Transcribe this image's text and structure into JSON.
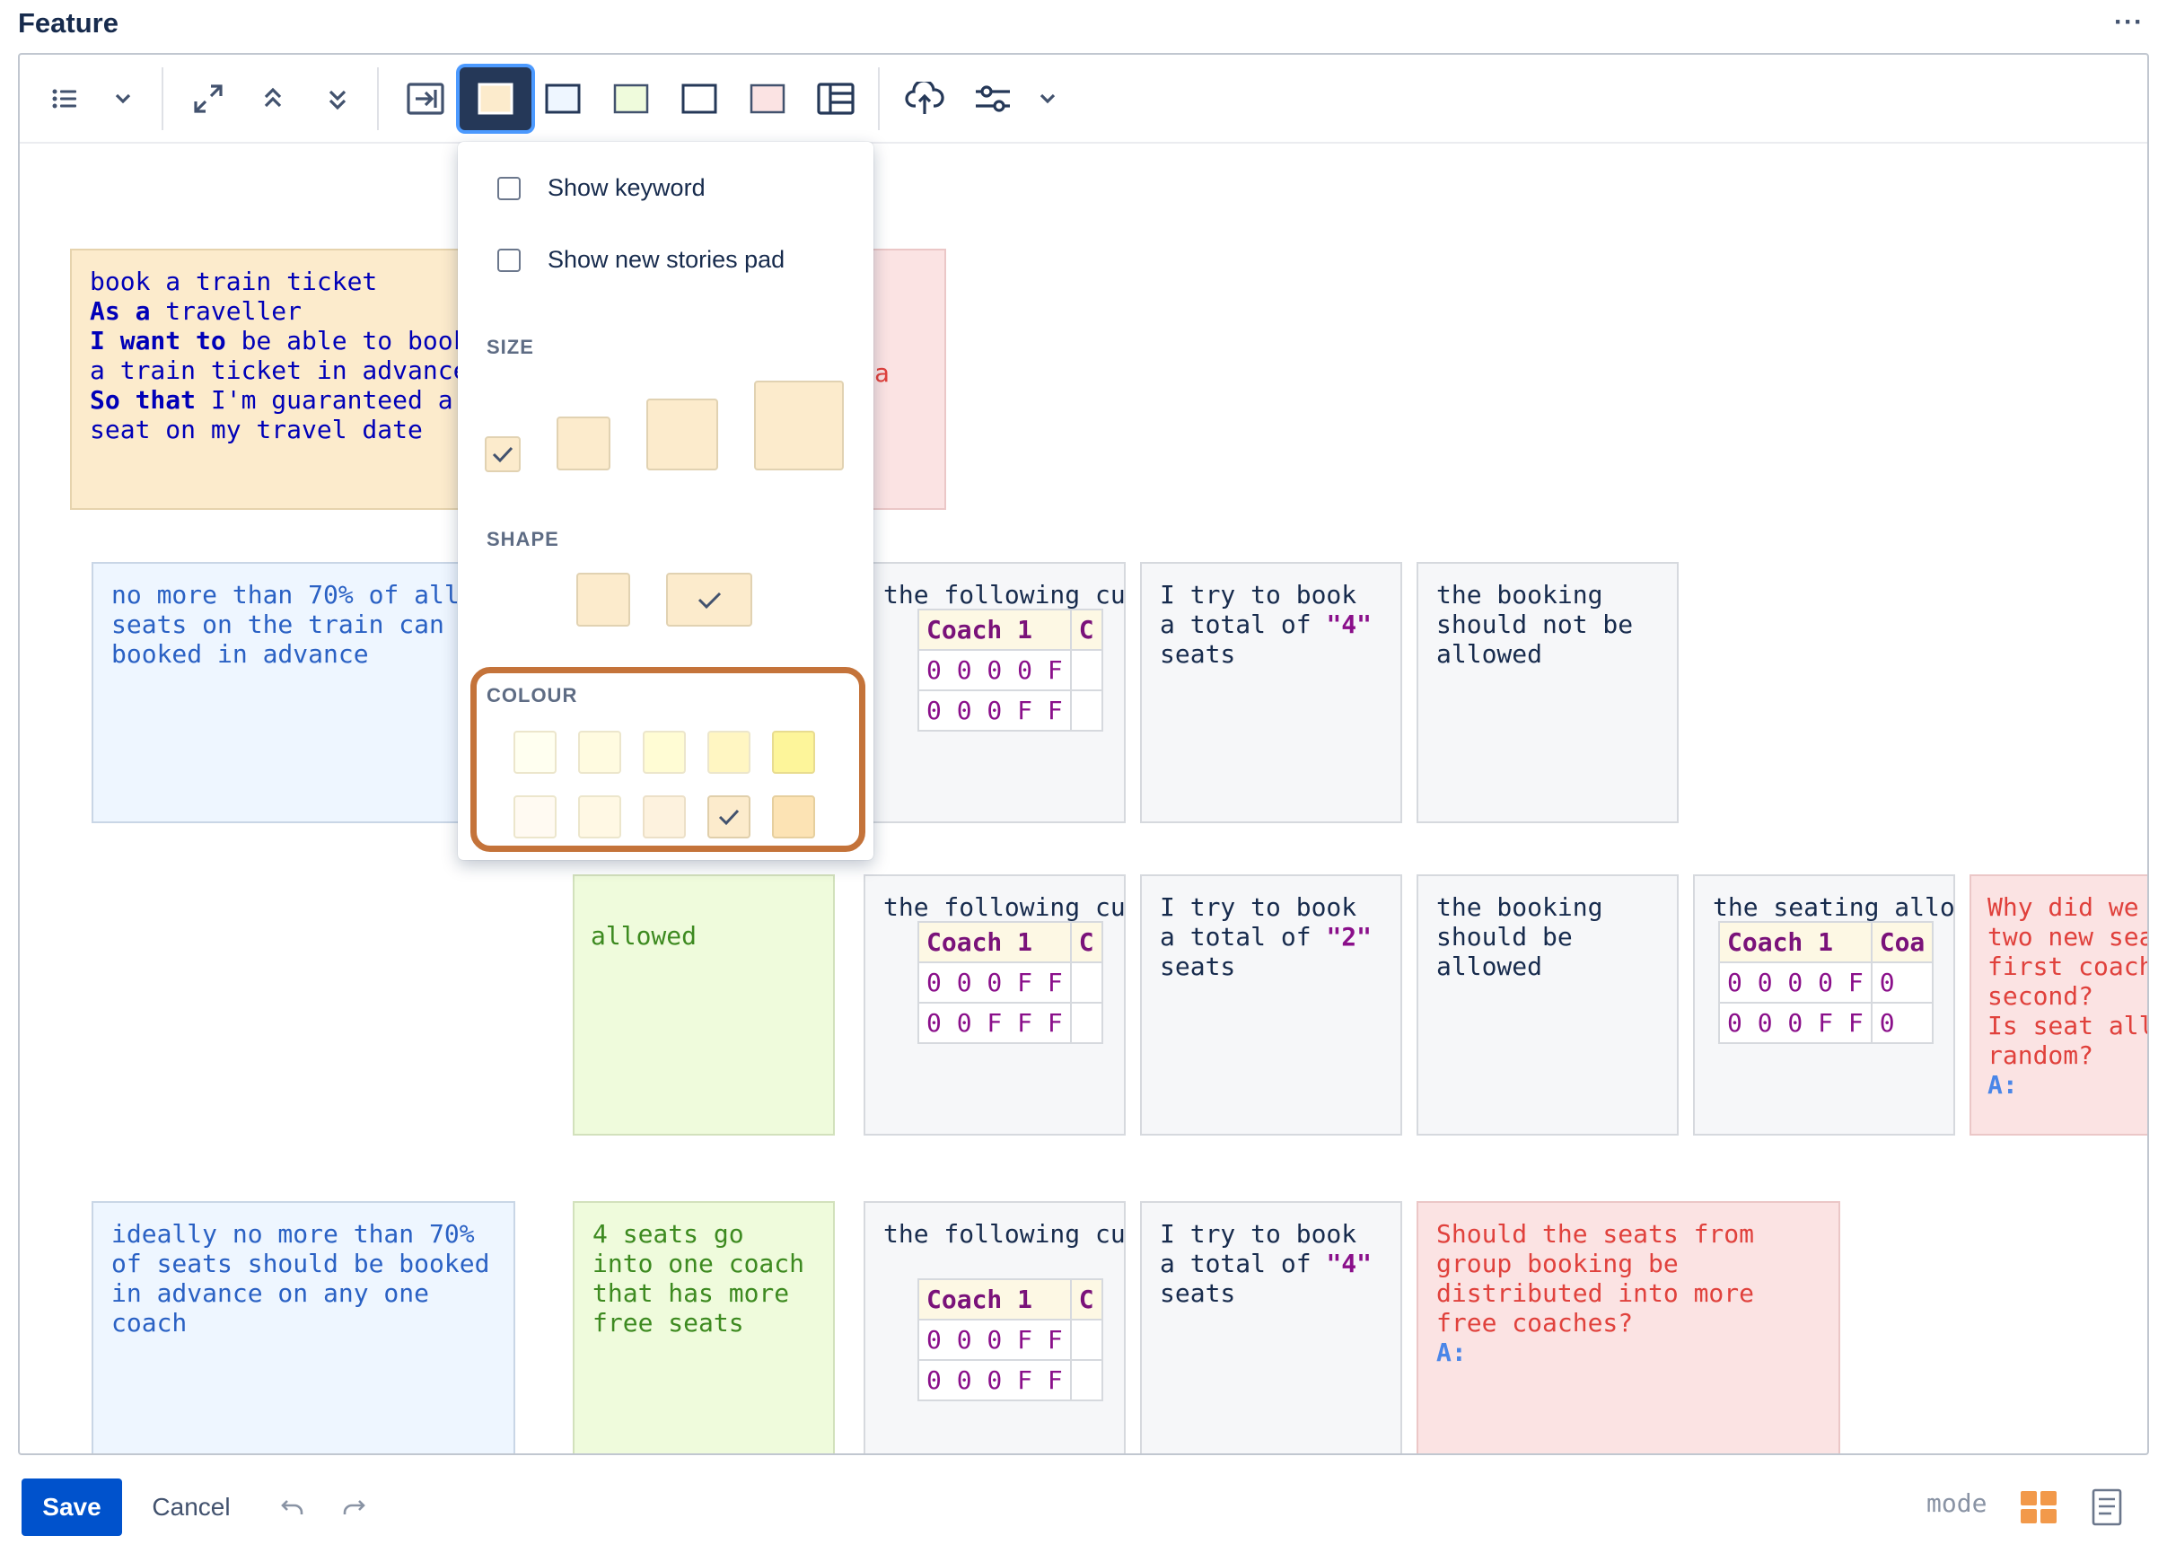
{
  "header": {
    "title": "Feature",
    "more": "···"
  },
  "colors": {
    "accent": "#0052cc",
    "highlight": "#c4733a",
    "active_tool": "#253858"
  },
  "toolbar": {
    "icons": [
      "list-icon",
      "chevron-down-icon",
      "expand-icon",
      "collapse-up-icon",
      "collapse-down-icon",
      "insert-icon",
      "story-card-icon",
      "blue-card-icon",
      "green-card-icon",
      "grey-card-icon",
      "pink-card-icon",
      "table-icon",
      "cloud-upload-icon",
      "sliders-icon",
      "chevron-down-icon"
    ]
  },
  "dropdown": {
    "show_keyword": "Show keyword",
    "show_new_stories_pad": "Show new stories pad",
    "size_label": "SIZE",
    "shape_label": "SHAPE",
    "colour_label": "COLOUR",
    "selected_size": 1,
    "selected_shape": 2,
    "selected_colour": 9
  },
  "cards": {
    "story": {
      "line1": "book a train ticket",
      "as_kw": "As a",
      "as_text": " traveller",
      "want_kw": "I want to",
      "want_text": " be able to book",
      "want_text2": "a train ticket in advance",
      "so_kw": "So that",
      "so_text": " I'm guaranteed a",
      "so_text2": "seat on my travel date"
    },
    "pink_top_fragment": "a",
    "rule1": "no more than 70% of all\nseats on the train can\nbooked in advance",
    "rule2": "ideally no more than 70%\nof seats should be booked\nin advance on any one\ncoach",
    "green_row2_fragment": "allowed",
    "green_row3": "4 seats go\ninto one coach\nthat has more\nfree seats",
    "given": "the following cu",
    "given_seating": "the seating allo",
    "when_prefix": "I try to book\na total of ",
    "when_4": "\"4\"",
    "when_2": "\"2\"",
    "when_suffix": "\nseats",
    "then_not_allowed": "the booking\nshould not be\nallowed",
    "then_allowed": "the booking\nshould be\nallowed",
    "question1": "Why did we\ntwo new sea\nfirst coach\nsecond?\nIs seat all\nrandom?",
    "question2": "Should the seats from\ngroup booking be\ndistributed into more\nfree coaches?",
    "answer_label": "A:"
  },
  "tables": {
    "coach1": "Coach 1",
    "coach_frag_c": "C",
    "coach_frag_coa": "Coa",
    "row_0000F": "0 0 0 0 F",
    "row_000FF": "0 0 0 F F",
    "row_00FFF": "0 0 F F F",
    "zero": "0"
  },
  "footer": {
    "save": "Save",
    "cancel": "Cancel",
    "mode": "mode"
  }
}
